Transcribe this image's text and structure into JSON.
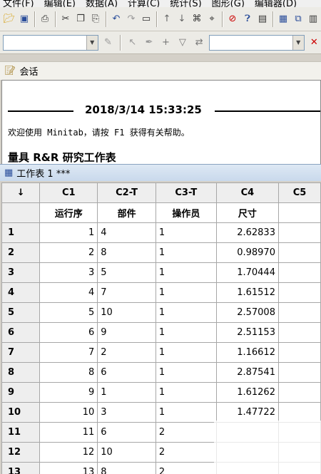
{
  "menubar": {
    "items": [
      "文件(F)",
      "编辑(E)",
      "数据(A)",
      "计算(C)",
      "统计(S)",
      "图形(G)",
      "编辑器(D)"
    ]
  },
  "toolbar1": {
    "icons": [
      "open-icon",
      "save-icon",
      "print-icon",
      "cut-icon",
      "copy-icon",
      "paste-icon",
      "undo-icon",
      "redo-icon",
      "window-icon",
      "arrow-up-icon",
      "arrow-down-icon",
      "find-icon",
      "cancel-icon",
      "help-icon",
      "info-icon",
      "tile-icon",
      "cascade-icon"
    ]
  },
  "session": {
    "title": "会话",
    "timestamp": "2018/3/14 15:33:25",
    "welcome": "欢迎使用 Minitab，请按 F1 获得有关帮助。",
    "study_title": "量具 R&R 研究工作表"
  },
  "worksheet": {
    "title": "工作表 1 ***",
    "corner": "↓",
    "columns": [
      "C1",
      "C2-T",
      "C3-T",
      "C4",
      "C5"
    ],
    "names": [
      "运行序",
      "部件",
      "操作员",
      "尺寸",
      ""
    ],
    "rows": [
      {
        "n": "1",
        "c1": "1",
        "c2": "4",
        "c3": "1",
        "c4": "2.62833"
      },
      {
        "n": "2",
        "c1": "2",
        "c2": "8",
        "c3": "1",
        "c4": "0.98970"
      },
      {
        "n": "3",
        "c1": "3",
        "c2": "5",
        "c3": "1",
        "c4": "1.70444"
      },
      {
        "n": "4",
        "c1": "4",
        "c2": "7",
        "c3": "1",
        "c4": "1.61512"
      },
      {
        "n": "5",
        "c1": "5",
        "c2": "10",
        "c3": "1",
        "c4": "2.57008"
      },
      {
        "n": "6",
        "c1": "6",
        "c2": "9",
        "c3": "1",
        "c4": "2.51153"
      },
      {
        "n": "7",
        "c1": "7",
        "c2": "2",
        "c3": "1",
        "c4": "1.16612"
      },
      {
        "n": "8",
        "c1": "8",
        "c2": "6",
        "c3": "1",
        "c4": "2.87541"
      },
      {
        "n": "9",
        "c1": "9",
        "c2": "1",
        "c3": "1",
        "c4": "1.61262"
      },
      {
        "n": "10",
        "c1": "10",
        "c2": "3",
        "c3": "1",
        "c4": "1.47722"
      },
      {
        "n": "11",
        "c1": "11",
        "c2": "6",
        "c3": "2",
        "c4": ""
      },
      {
        "n": "12",
        "c1": "12",
        "c2": "10",
        "c3": "2",
        "c4": ""
      },
      {
        "n": "13",
        "c1": "13",
        "c2": "8",
        "c3": "2",
        "c4": ""
      }
    ]
  }
}
